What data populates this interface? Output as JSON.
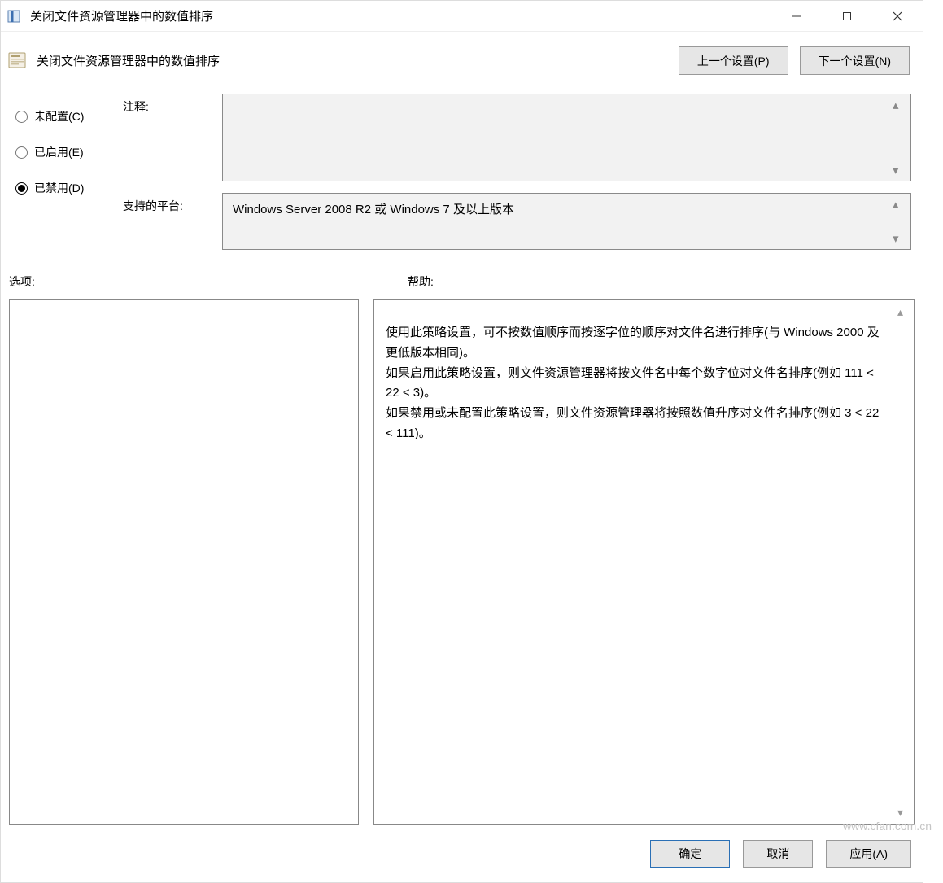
{
  "window": {
    "title": "关闭文件资源管理器中的数值排序"
  },
  "header": {
    "heading": "关闭文件资源管理器中的数值排序",
    "prev_btn": "上一个设置(P)",
    "next_btn": "下一个设置(N)"
  },
  "radios": {
    "not_configured": "未配置(C)",
    "enabled": "已启用(E)",
    "disabled": "已禁用(D)",
    "selected": "disabled"
  },
  "fields": {
    "comment_label": "注释:",
    "comment_value": "",
    "supported_label": "支持的平台:",
    "supported_value": "Windows Server 2008 R2 或 Windows 7 及以上版本"
  },
  "labels": {
    "options": "选项:",
    "help": "帮助:"
  },
  "help_text": "使用此策略设置，可不按数值顺序而按逐字位的顺序对文件名进行排序(与 Windows 2000 及更低版本相同)。\n如果启用此策略设置，则文件资源管理器将按文件名中每个数字位对文件名排序(例如 111 < 22 < 3)。\n如果禁用或未配置此策略设置，则文件资源管理器将按照数值升序对文件名排序(例如 3 < 22 < 111)。",
  "footer": {
    "ok": "确定",
    "cancel": "取消",
    "apply": "应用(A)"
  },
  "watermark": "www.cfan.com.cn"
}
